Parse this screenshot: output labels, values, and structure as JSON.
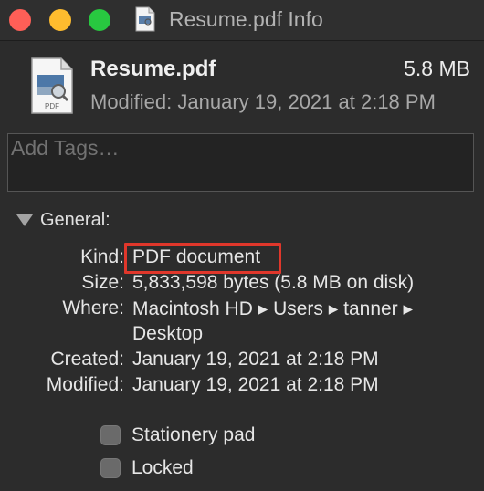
{
  "window": {
    "title": "Resume.pdf Info",
    "traffic_lights": {
      "close": "#fe5f57",
      "minimize": "#febc2e",
      "maximize": "#28c840"
    }
  },
  "file": {
    "name": "Resume.pdf",
    "size": "5.8 MB",
    "modified": "Modified: January 19, 2021 at 2:18 PM",
    "icon_label": "PDF",
    "icon": "pdf-document-icon"
  },
  "tags": {
    "placeholder": "Add Tags…",
    "value": ""
  },
  "general": {
    "label": "General:",
    "expanded": true,
    "rows": [
      {
        "label": "Kind:",
        "value": "PDF document"
      },
      {
        "label": "Size:",
        "value": "5,833,598 bytes (5.8 MB on disk)"
      },
      {
        "label": "Where:",
        "value": "Macintosh HD ▸ Users ▸ tanner ▸"
      },
      {
        "label": "",
        "value": "Desktop"
      },
      {
        "label": "Created:",
        "value": "January 19, 2021 at 2:18 PM"
      },
      {
        "label": "Modified:",
        "value": "January 19, 2021 at 2:18 PM"
      }
    ],
    "highlight_color": "#e0372b"
  },
  "options": [
    {
      "label": "Stationery pad",
      "checked": false
    },
    {
      "label": "Locked",
      "checked": false
    }
  ]
}
